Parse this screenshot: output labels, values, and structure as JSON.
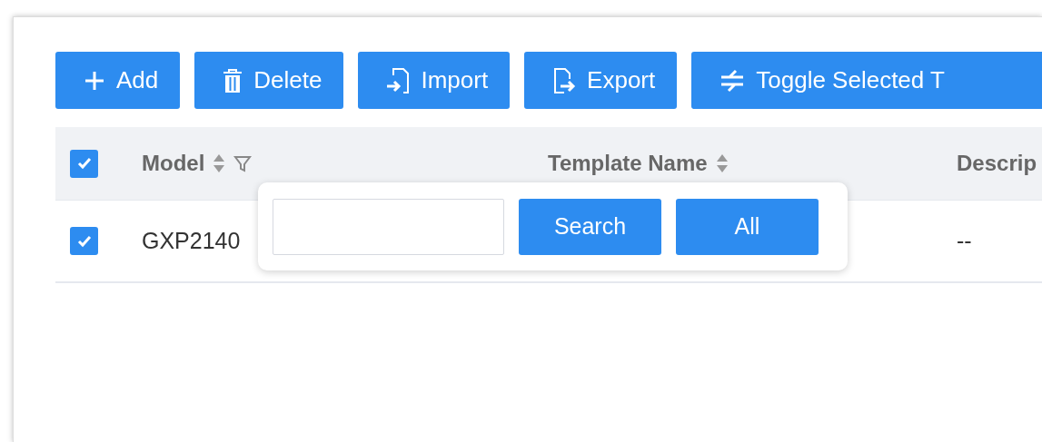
{
  "toolbar": [
    {
      "kind": "add",
      "label": "Add"
    },
    {
      "kind": "delete",
      "label": "Delete"
    },
    {
      "kind": "import",
      "label": "Import"
    },
    {
      "kind": "export",
      "label": "Export"
    },
    {
      "kind": "toggle",
      "label": "Toggle Selected T"
    }
  ],
  "table": {
    "select_all": {
      "checked": true
    },
    "columns": [
      {
        "label": "Model",
        "sortable": true,
        "filterable": true
      },
      {
        "label": "Template Name",
        "sortable": true,
        "filterable": false
      },
      {
        "label": "Descrip"
      }
    ],
    "rows": [
      {
        "checked": true,
        "cells": [
          "GXP2140",
          "",
          "--"
        ]
      }
    ]
  },
  "filter_popup": {
    "buttons": [
      "Search",
      "All"
    ]
  }
}
